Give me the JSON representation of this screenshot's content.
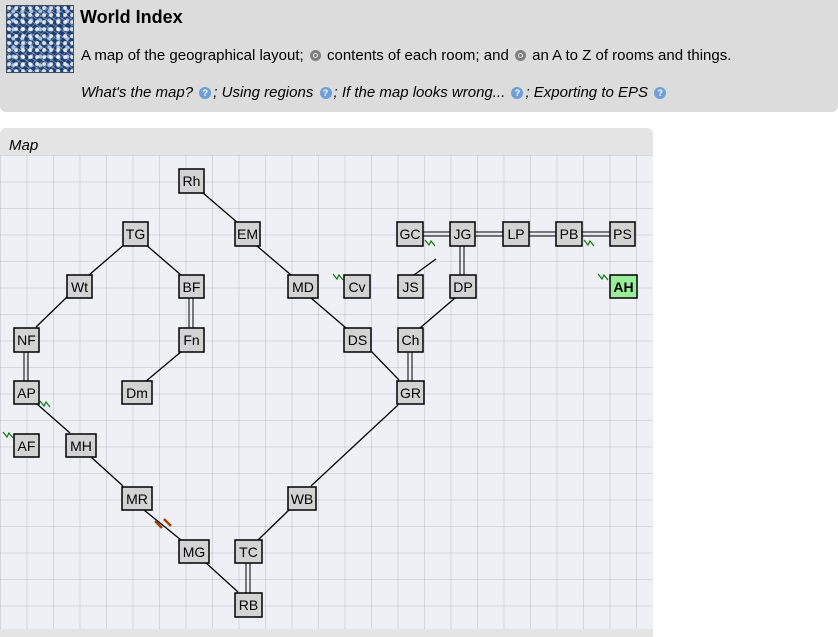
{
  "header": {
    "title": "World Index",
    "desc_part1": "A map of the geographical layout;",
    "desc_part2": "contents of each room; and",
    "desc_part3": "an A to Z of rooms and things.",
    "link_map": "What's the map?",
    "link_regions": "Using regions",
    "link_wrong": "If the map looks wrong...",
    "link_eps": "Exporting to EPS",
    "sep": ";"
  },
  "panel": {
    "title": "Map"
  },
  "rooms": {
    "Rh": "Rh",
    "TG": "TG",
    "EM": "EM",
    "GC": "GC",
    "JG": "JG",
    "LP": "LP",
    "PB": "PB",
    "PS": "PS",
    "Wt": "Wt",
    "BF": "BF",
    "MD": "MD",
    "Cv": "Cv",
    "JS": "JS",
    "DP": "DP",
    "AH": "AH",
    "NF": "NF",
    "Fn": "Fn",
    "DS": "DS",
    "Ch": "Ch",
    "AP": "AP",
    "Dm": "Dm",
    "GR": "GR",
    "AF": "AF",
    "MH": "MH",
    "MR": "MR",
    "WB": "WB",
    "MG": "MG",
    "TC": "TC",
    "RB": "RB"
  },
  "current_room": "AH",
  "colors": {
    "current": "#99ee99",
    "room": "#d3d3d3",
    "door": "#a04000",
    "teleport": "#117711"
  }
}
